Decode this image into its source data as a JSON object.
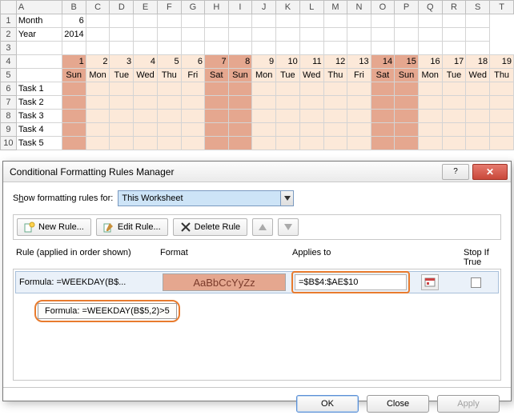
{
  "columns": [
    "A",
    "B",
    "C",
    "D",
    "E",
    "F",
    "G",
    "H",
    "I",
    "J",
    "K",
    "L",
    "M",
    "N",
    "O",
    "P",
    "Q",
    "R",
    "S",
    "T"
  ],
  "rows": [
    "1",
    "2",
    "3",
    "4",
    "5",
    "6",
    "7",
    "8",
    "9",
    "10"
  ],
  "cells": {
    "A1": "Month",
    "B1": "6",
    "A2": "Year",
    "B2": "2014"
  },
  "daynums": [
    "1",
    "2",
    "3",
    "4",
    "5",
    "6",
    "7",
    "8",
    "9",
    "10",
    "11",
    "12",
    "13",
    "14",
    "15",
    "16",
    "17",
    "18",
    "19"
  ],
  "daylbls": [
    "Sun",
    "Mon",
    "Tue",
    "Wed",
    "Thu",
    "Fri",
    "Sat",
    "Sun",
    "Mon",
    "Tue",
    "Wed",
    "Thu",
    "Fri",
    "Sat",
    "Sun",
    "Mon",
    "Tue",
    "Wed",
    "Thu"
  ],
  "weekend_idx": [
    0,
    6,
    7,
    13,
    14
  ],
  "tasks": [
    "Task 1",
    "Task 2",
    "Task 3",
    "Task 4",
    "Task 5"
  ],
  "dialog": {
    "title": "Conditional Formatting Rules Manager",
    "show_label_pre": "S",
    "show_label_u": "h",
    "show_label_post": "ow formatting rules for:",
    "scope": "This Worksheet",
    "new_rule": "New Rule...",
    "edit_rule": "Edit Rule...",
    "delete_rule": "Delete Rule",
    "hdr_rule": "Rule (applied in order shown)",
    "hdr_format": "Format",
    "hdr_applies": "Applies to",
    "hdr_stop": "Stop If True",
    "rule_text": "Formula: =WEEKDAY(B$...",
    "format_sample": "AaBbCcYyZz",
    "applies_to": "=$B$4:$AE$10",
    "tooltip": "Formula: =WEEKDAY(B$5,2)>5",
    "ok": "OK",
    "close": "Close",
    "apply": "Apply"
  }
}
